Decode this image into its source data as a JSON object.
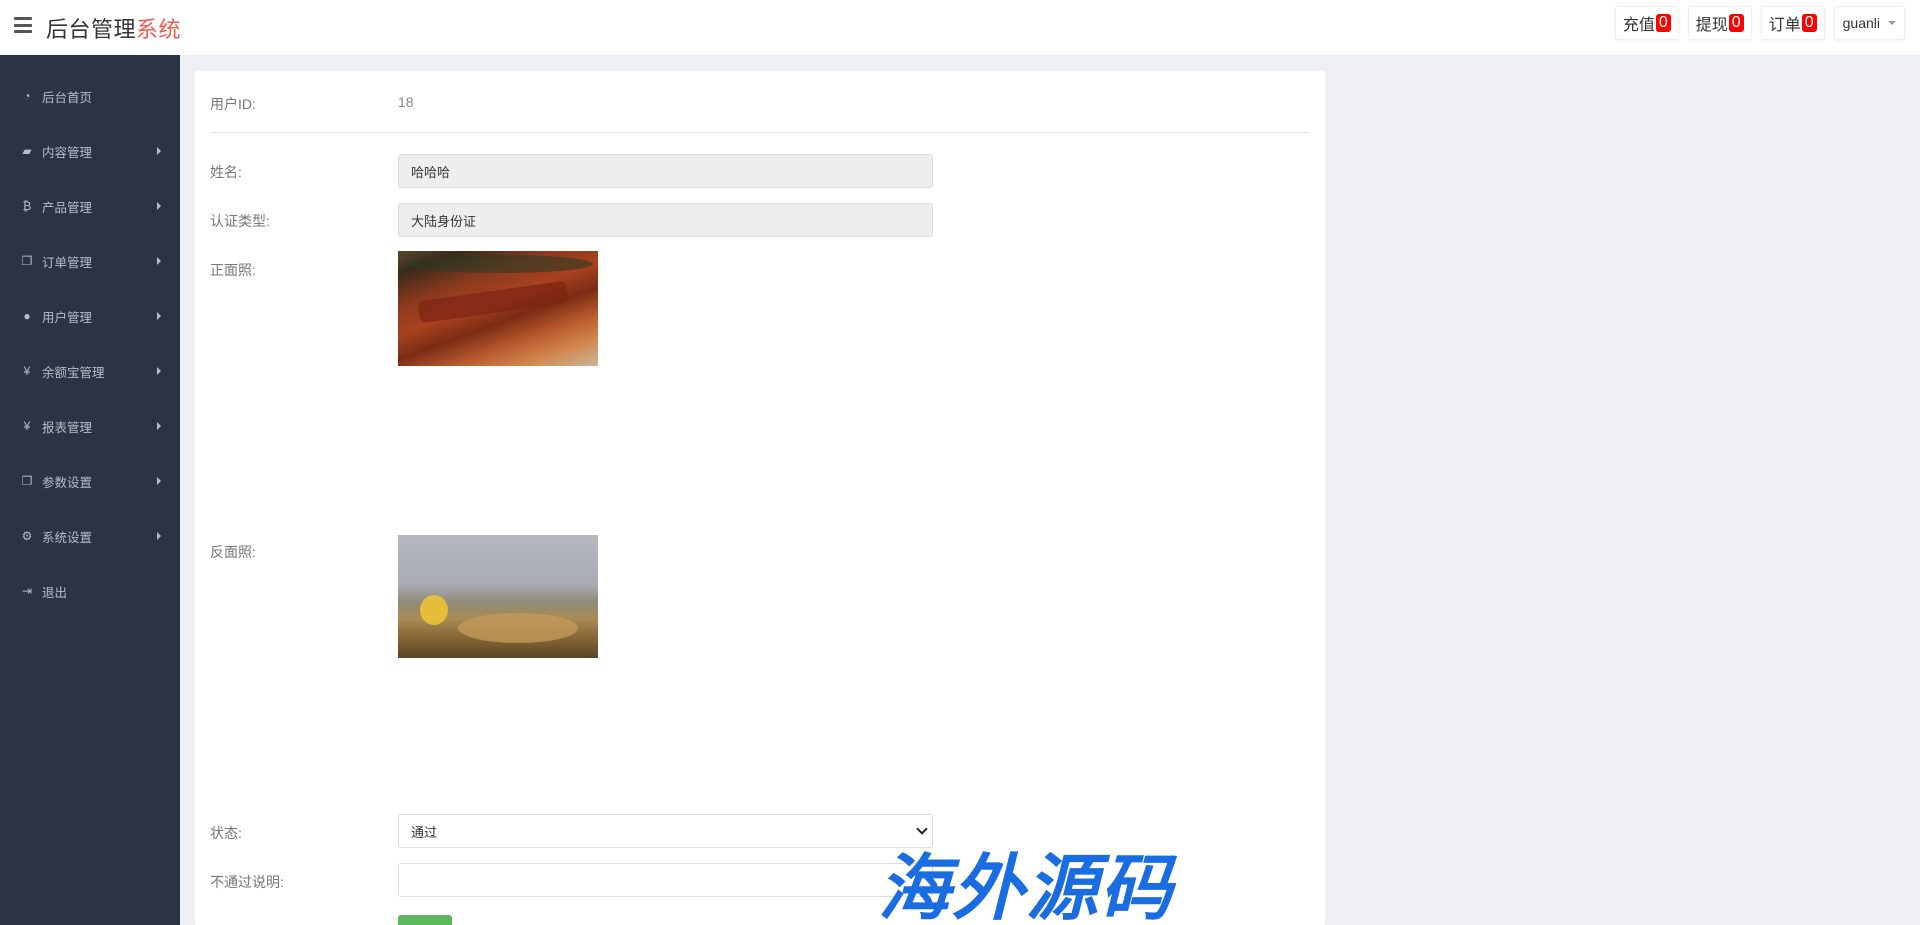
{
  "header": {
    "title_main": "后台管理",
    "title_accent": "系统",
    "recharge_label": "充值",
    "recharge_count": "0",
    "withdraw_label": "提现",
    "withdraw_count": "0",
    "order_label": "订单",
    "order_count": "0",
    "username": "guanli"
  },
  "sidebar": {
    "items": [
      {
        "label": "后台首页",
        "icon": "dashboard-icon"
      },
      {
        "label": "内容管理",
        "icon": "book-icon"
      },
      {
        "label": "产品管理",
        "icon": "bitcoin-icon"
      },
      {
        "label": "订单管理",
        "icon": "copy-icon"
      },
      {
        "label": "用户管理",
        "icon": "user-icon"
      },
      {
        "label": "余额宝管理",
        "icon": "yen-icon"
      },
      {
        "label": "报表管理",
        "icon": "yen-icon"
      },
      {
        "label": "参数设置",
        "icon": "copy-icon"
      },
      {
        "label": "系统设置",
        "icon": "cogs-icon"
      },
      {
        "label": "退出",
        "icon": "sign-out-icon"
      }
    ]
  },
  "form": {
    "user_id_label": "用户ID:",
    "user_id_value": "18",
    "name_label": "姓名:",
    "name_value": "哈哈哈",
    "cert_type_label": "认证类型:",
    "cert_type_value": "大陆身份证",
    "front_photo_label": "正面照:",
    "back_photo_label": "反面照:",
    "status_label": "状态:",
    "status_value": "通过",
    "reject_reason_label": "不通过说明:",
    "reject_reason_value": ""
  },
  "watermark": "海外源码"
}
